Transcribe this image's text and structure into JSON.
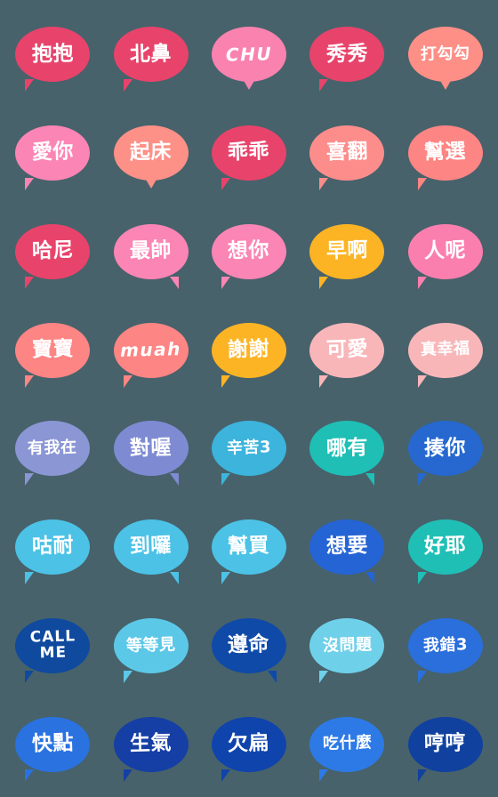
{
  "sheet": {
    "background_color": "#47626b",
    "text_color": "#ffffff",
    "columns": 5,
    "rows": 8,
    "count": 40
  },
  "stickers": [
    {
      "label": "抱抱",
      "color": "#e8436b",
      "tail": "left",
      "script": "han"
    },
    {
      "label": "北鼻",
      "color": "#e8436b",
      "tail": "left",
      "script": "han"
    },
    {
      "label": "CHU",
      "color": "#fa82ae",
      "tail": "center",
      "script": "latin"
    },
    {
      "label": "秀秀",
      "color": "#e8436b",
      "tail": "left",
      "script": "han"
    },
    {
      "label": "打勾勾",
      "color": "#fd8f87",
      "tail": "center",
      "script": "han"
    },
    {
      "label": "愛你",
      "color": "#fb85b4",
      "tail": "left",
      "script": "han"
    },
    {
      "label": "起床",
      "color": "#fd9087",
      "tail": "center",
      "script": "han"
    },
    {
      "label": "乖乖",
      "color": "#e8436b",
      "tail": "left",
      "script": "han"
    },
    {
      "label": "喜翻",
      "color": "#fd8d8b",
      "tail": "left",
      "script": "han"
    },
    {
      "label": "幫選",
      "color": "#fd8584",
      "tail": "left",
      "script": "han"
    },
    {
      "label": "哈尼",
      "color": "#e8436b",
      "tail": "left",
      "script": "han"
    },
    {
      "label": "最帥",
      "color": "#fb85b4",
      "tail": "right",
      "script": "han"
    },
    {
      "label": "想你",
      "color": "#fb85b4",
      "tail": "left",
      "script": "han"
    },
    {
      "label": "早啊",
      "color": "#fcb425",
      "tail": "left",
      "script": "han"
    },
    {
      "label": "人呢",
      "color": "#fb7fae",
      "tail": "left",
      "script": "han"
    },
    {
      "label": "寶寶",
      "color": "#fd8584",
      "tail": "left",
      "script": "han"
    },
    {
      "label": "muah",
      "color": "#fd8584",
      "tail": "left",
      "script": "latin"
    },
    {
      "label": "謝謝",
      "color": "#fcb425",
      "tail": "left",
      "script": "han"
    },
    {
      "label": "可愛",
      "color": "#f9b6b9",
      "tail": "left",
      "script": "han"
    },
    {
      "label": "真幸福",
      "color": "#f9b6b9",
      "tail": "left",
      "script": "han"
    },
    {
      "label": "有我在",
      "color": "#8b96d5",
      "tail": "left",
      "script": "han"
    },
    {
      "label": "對喔",
      "color": "#7e8bd2",
      "tail": "right",
      "script": "han"
    },
    {
      "label": "辛苦3",
      "color": "#3cb4dc",
      "tail": "left",
      "script": "han"
    },
    {
      "label": "哪有",
      "color": "#1fbfb5",
      "tail": "right",
      "script": "han"
    },
    {
      "label": "揍你",
      "color": "#2668d0",
      "tail": "left",
      "script": "han"
    },
    {
      "label": "咕耐",
      "color": "#4cc2e6",
      "tail": "left",
      "script": "han"
    },
    {
      "label": "到囉",
      "color": "#4cc2e6",
      "tail": "right",
      "script": "han"
    },
    {
      "label": "幫買",
      "color": "#4cc2e6",
      "tail": "left",
      "script": "han"
    },
    {
      "label": "想要",
      "color": "#2464d4",
      "tail": "right",
      "script": "han"
    },
    {
      "label": "好耶",
      "color": "#1fbfb5",
      "tail": "left",
      "script": "han"
    },
    {
      "label": "CALL\nME",
      "color": "#0f4a9e",
      "tail": "left",
      "script": "latin-stack"
    },
    {
      "label": "等等見",
      "color": "#5cc8e8",
      "tail": "left",
      "script": "han"
    },
    {
      "label": "遵命",
      "color": "#0f4aa8",
      "tail": "right",
      "script": "han"
    },
    {
      "label": "沒問題",
      "color": "#6fd0ea",
      "tail": "left",
      "script": "han"
    },
    {
      "label": "我錯3",
      "color": "#2a6fdb",
      "tail": "left",
      "script": "han"
    },
    {
      "label": "快點",
      "color": "#2a72e0",
      "tail": "left",
      "script": "han"
    },
    {
      "label": "生氣",
      "color": "#153fa4",
      "tail": "left",
      "script": "han"
    },
    {
      "label": "欠扁",
      "color": "#0f44ad",
      "tail": "left",
      "script": "han"
    },
    {
      "label": "吃什麼",
      "color": "#2d7ae6",
      "tail": "left",
      "script": "han"
    },
    {
      "label": "哼哼",
      "color": "#11419f",
      "tail": "left",
      "script": "han"
    }
  ]
}
